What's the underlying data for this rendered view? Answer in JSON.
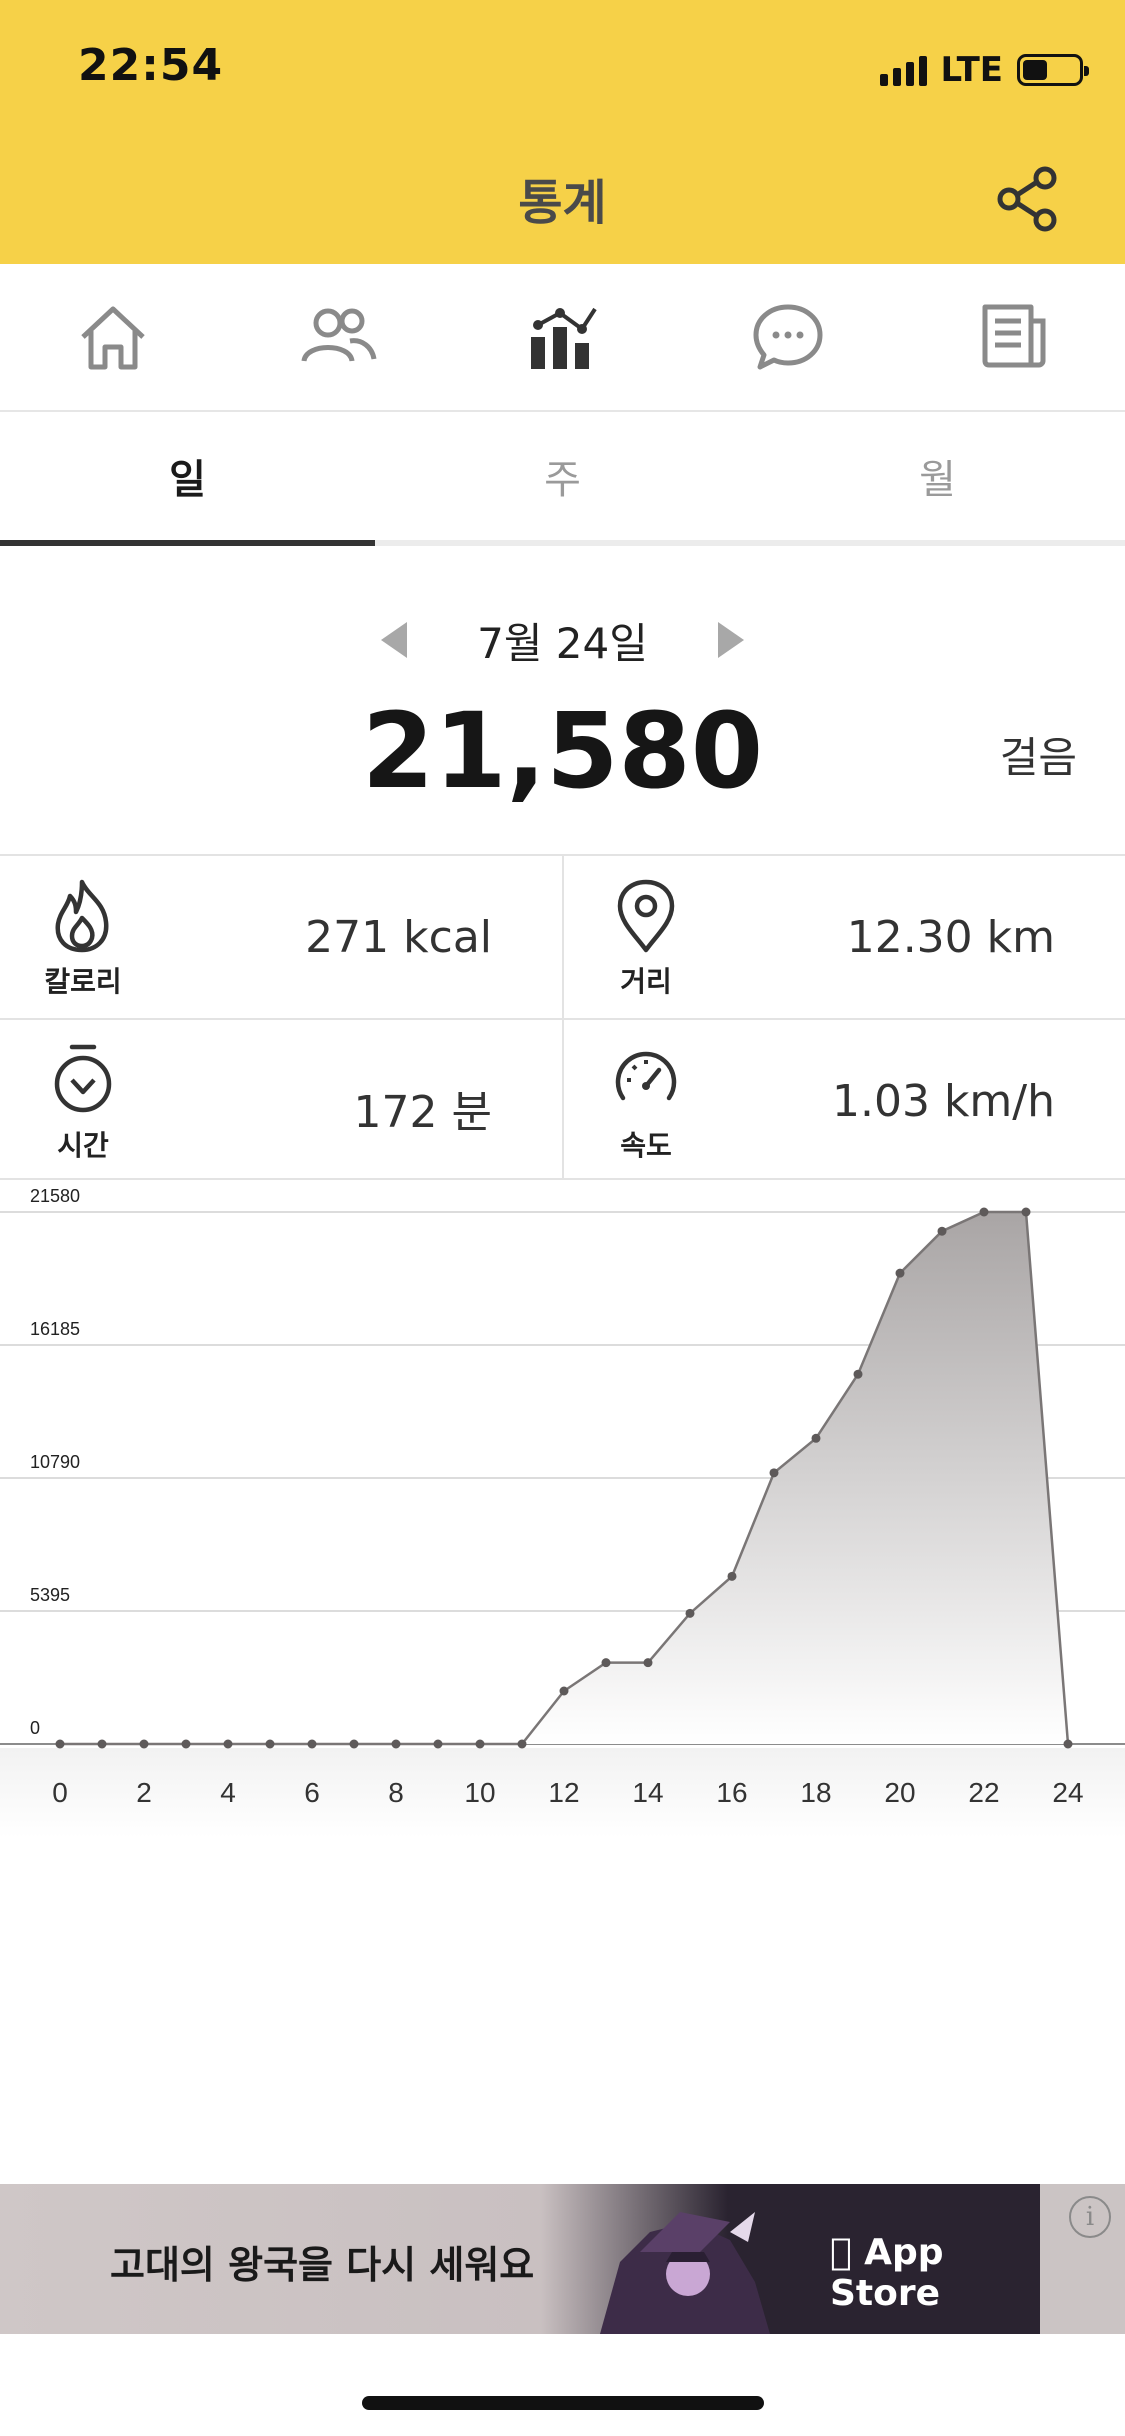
{
  "status_bar": {
    "time": "22:54",
    "network": "LTE",
    "battery_level": 0.45
  },
  "header": {
    "title": "통계",
    "share_icon": "share-icon"
  },
  "nav": [
    {
      "id": "home",
      "icon": "home-icon"
    },
    {
      "id": "friends",
      "icon": "people-icon"
    },
    {
      "id": "stats",
      "icon": "bar-chart-icon",
      "active": true
    },
    {
      "id": "chat",
      "icon": "chat-bubble-icon"
    },
    {
      "id": "news",
      "icon": "newspaper-icon"
    }
  ],
  "tabs": [
    {
      "label": "일",
      "active": true
    },
    {
      "label": "주",
      "active": false
    },
    {
      "label": "월",
      "active": false
    }
  ],
  "summary": {
    "date": "7월 24일",
    "steps": "21,580",
    "unit": "걸음"
  },
  "stats": [
    {
      "icon": "flame-icon",
      "label": "칼로리",
      "value": "271 kcal"
    },
    {
      "icon": "location-pin-icon",
      "label": "거리",
      "value": "12.30 km"
    },
    {
      "icon": "stopwatch-icon",
      "label": "시간",
      "value": "172 분"
    },
    {
      "icon": "speedometer-icon",
      "label": "속도",
      "value": "1.03 km/h"
    }
  ],
  "chart_data": {
    "type": "area",
    "x": [
      0,
      1,
      2,
      3,
      4,
      5,
      6,
      7,
      8,
      9,
      10,
      11,
      12,
      13,
      14,
      15,
      16,
      17,
      18,
      19,
      20,
      21,
      22,
      23,
      24
    ],
    "series": [
      {
        "values": [
          0,
          0,
          0,
          0,
          0,
          0,
          0,
          0,
          0,
          0,
          0,
          0,
          2150,
          3300,
          3300,
          5300,
          6800,
          11000,
          12400,
          15000,
          19100,
          20800,
          21580,
          21580,
          0
        ]
      }
    ],
    "yticks": [
      "0",
      "5395",
      "10790",
      "16185",
      "21580"
    ],
    "xticks": [
      "0",
      "2",
      "4",
      "6",
      "8",
      "10",
      "12",
      "14",
      "16",
      "18",
      "20",
      "22",
      "24"
    ],
    "ylim": [
      0,
      21580
    ],
    "xlim": [
      0,
      24
    ],
    "grid": true,
    "fill_color": "#a9a5a5",
    "line_color": "#7a7676"
  },
  "ad": {
    "text": "고대의 왕국을 다시 세워요",
    "store_label": "App Store",
    "info_label": "i"
  },
  "colors": {
    "header_bg": "#f6d148",
    "active_tab_underline": "#333333"
  }
}
